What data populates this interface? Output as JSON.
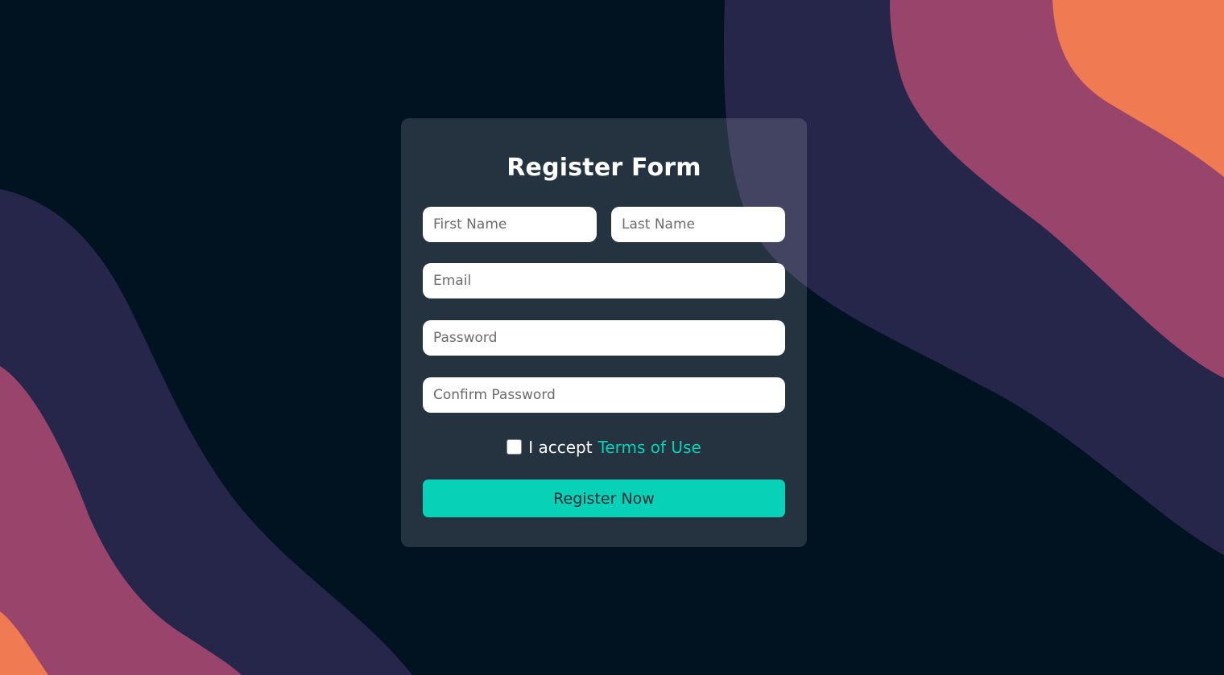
{
  "form": {
    "title": "Register Form",
    "first_name_placeholder": "First Name",
    "last_name_placeholder": "Last Name",
    "email_placeholder": "Email",
    "password_placeholder": "Password",
    "confirm_password_placeholder": "Confirm Password",
    "terms_prefix": "I accept",
    "terms_link": "Terms of Use",
    "terms_checked": false,
    "submit_label": "Register Now"
  },
  "colors": {
    "background": "#011220",
    "wave_navy": "#252649",
    "wave_plum": "#99446b",
    "wave_orange": "#f07b52",
    "accent": "#07d2b8"
  }
}
